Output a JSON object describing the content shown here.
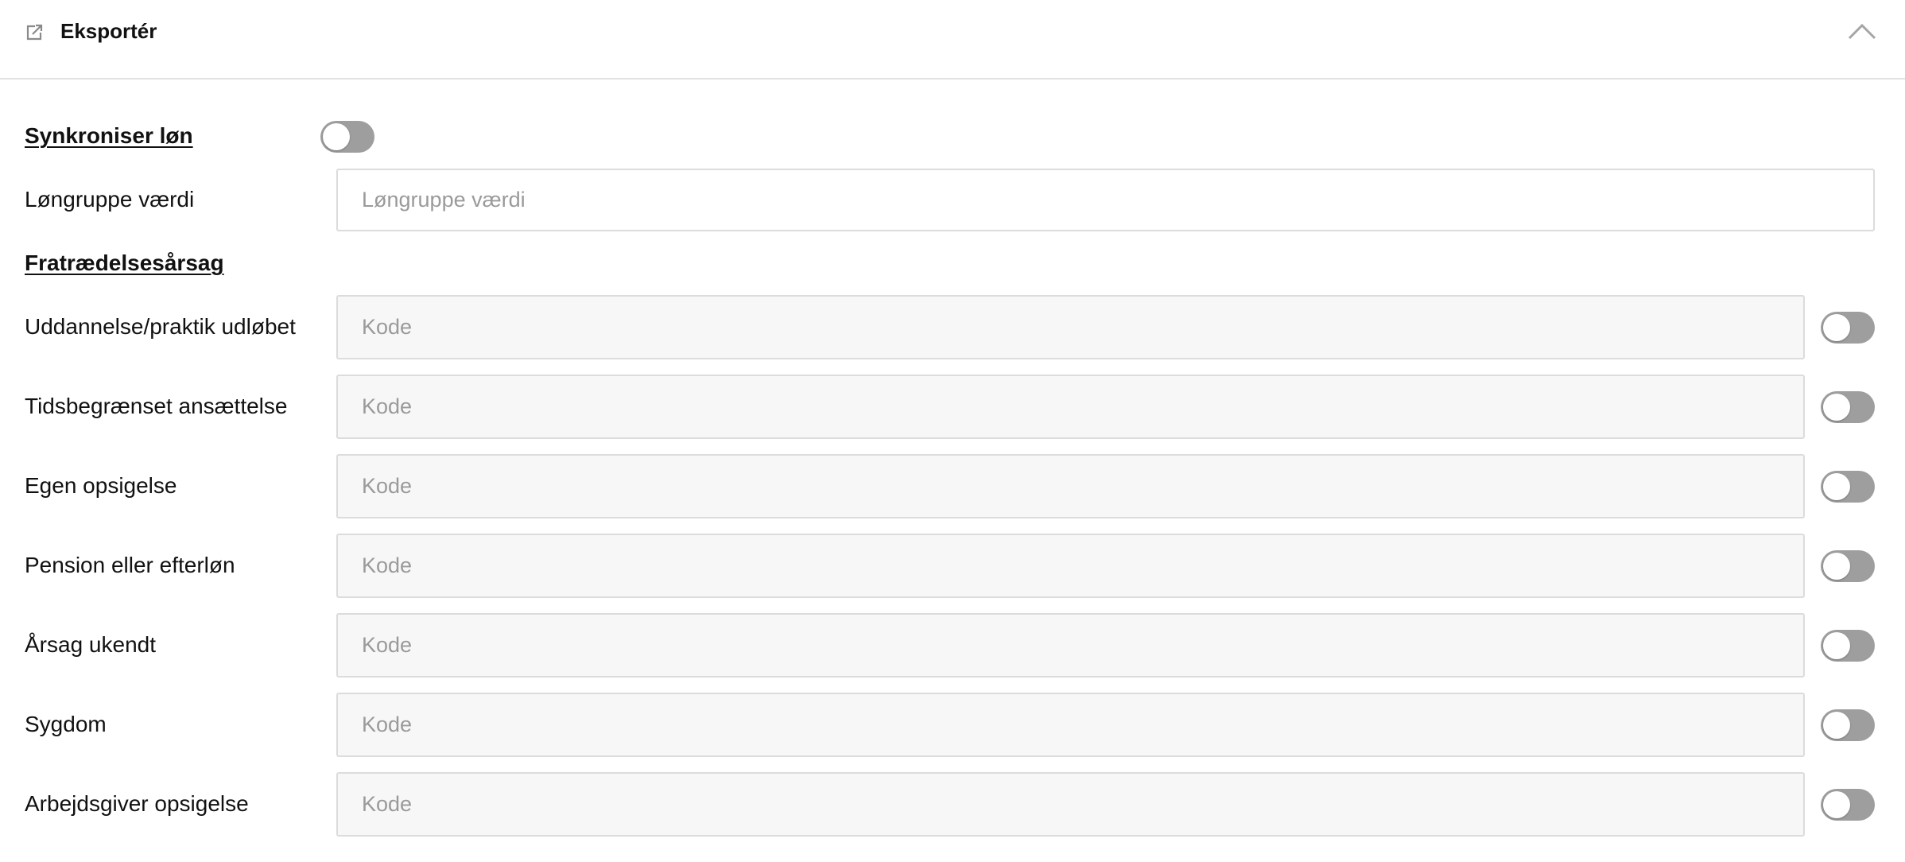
{
  "header": {
    "title": "Eksportér",
    "icon": "export-icon",
    "collapse_icon": "chevron-up-icon"
  },
  "sync_salary": {
    "label": "Synkroniser løn",
    "enabled": false
  },
  "salary_group": {
    "label": "Løngruppe værdi",
    "placeholder": "Løngruppe værdi",
    "value": ""
  },
  "termination": {
    "section_label": "Fratrædelsesårsag",
    "code_placeholder": "Kode",
    "reasons": [
      {
        "label": "Uddannelse/praktik udløbet",
        "value": "",
        "enabled": false
      },
      {
        "label": "Tidsbegrænset ansættelse",
        "value": "",
        "enabled": false
      },
      {
        "label": "Egen opsigelse",
        "value": "",
        "enabled": false
      },
      {
        "label": "Pension eller efterløn",
        "value": "",
        "enabled": false
      },
      {
        "label": "Årsag ukendt",
        "value": "",
        "enabled": false
      },
      {
        "label": "Sygdom",
        "value": "",
        "enabled": false
      },
      {
        "label": "Arbejdsgiver opsigelse",
        "value": "",
        "enabled": false
      }
    ]
  },
  "colors": {
    "toggle_off": "#9e9e9e",
    "input_disabled_bg": "#f7f7f7",
    "border": "#dcdcdc",
    "placeholder": "#9a9a9a"
  }
}
